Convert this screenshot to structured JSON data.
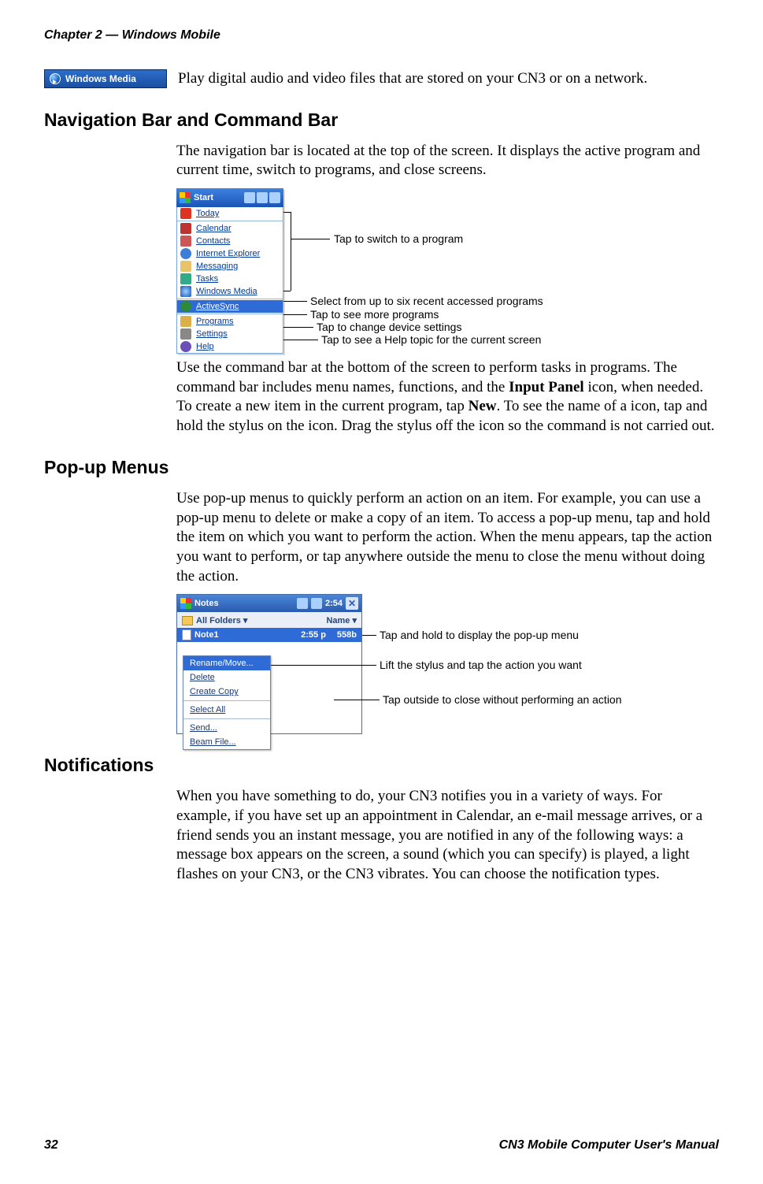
{
  "header": {
    "chapter": "Chapter 2 — Windows Mobile"
  },
  "footer": {
    "page": "32",
    "manual": "CN3 Mobile Computer User's Manual"
  },
  "wm_row": {
    "badge": "Windows Media",
    "text": "Play digital audio and video files that are stored on your CN3 or on a network."
  },
  "sections": {
    "navbar": {
      "title": "Navigation Bar and Command Bar",
      "intro": "The navigation bar is located at the top of the screen. It displays the active program and current time, switch to programs, and close screens.",
      "cmdbar_p1": "Use the command bar at the bottom of the screen to perform tasks in programs. The command bar includes menu names, functions, and the ",
      "cmdbar_bold1": "Input Panel",
      "cmdbar_p2": " icon, when needed. To create a new item in the current program, tap ",
      "cmdbar_bold2": "New",
      "cmdbar_p3": ". To see the name of a icon, tap and hold the stylus on the icon. Drag the stylus off the icon so the command is not carried out."
    },
    "popup": {
      "title": "Pop-up Menus",
      "text": "Use pop-up menus to quickly perform an action on an item. For example, you can use a pop-up menu to delete or make a copy of an item. To access a pop-up menu, tap and hold the item on which you want to perform the action. When the menu appears, tap the action you want to perform, or tap anywhere outside the menu to close the menu without doing the action."
    },
    "notif": {
      "title": "Notifications",
      "text": "When you have something to do, your CN3 notifies you in a variety of ways. For example, if you have set up an appointment in Calendar, an e-mail message arrives, or a friend sends you an instant message, you are notified in any of the following ways: a message box appears on the screen, a sound (which you can specify) is played, a light flashes on your CN3, or the CN3 vibrates. You can choose the notification types."
    }
  },
  "fig1": {
    "start": "Start",
    "items": [
      "Today",
      "Calendar",
      "Contacts",
      "Internet Explorer",
      "Messaging",
      "Tasks",
      "Windows Media",
      "ActiveSync",
      "Programs",
      "Settings",
      "Help"
    ],
    "callouts": {
      "switch": "Tap to switch to a program",
      "recent": "Select from up to six recent accessed programs",
      "programs": "Tap to see more programs",
      "settings": "Tap to change device settings",
      "help": "Tap to see a Help topic for the current screen"
    }
  },
  "fig2": {
    "title": "Notes",
    "time": "2:54",
    "folders": "All Folders",
    "name_col": "Name",
    "note_name": "Note1",
    "note_time": "2:55 p",
    "note_size": "558b",
    "popup_items": [
      "Rename/Move...",
      "Delete",
      "Create Copy",
      "Select All",
      "Send...",
      "Beam File..."
    ],
    "callouts": {
      "hold": "Tap and hold to display the pop-up menu",
      "lift": "Lift the stylus and tap the action you want",
      "outside": "Tap outside to close without performing an action"
    }
  }
}
